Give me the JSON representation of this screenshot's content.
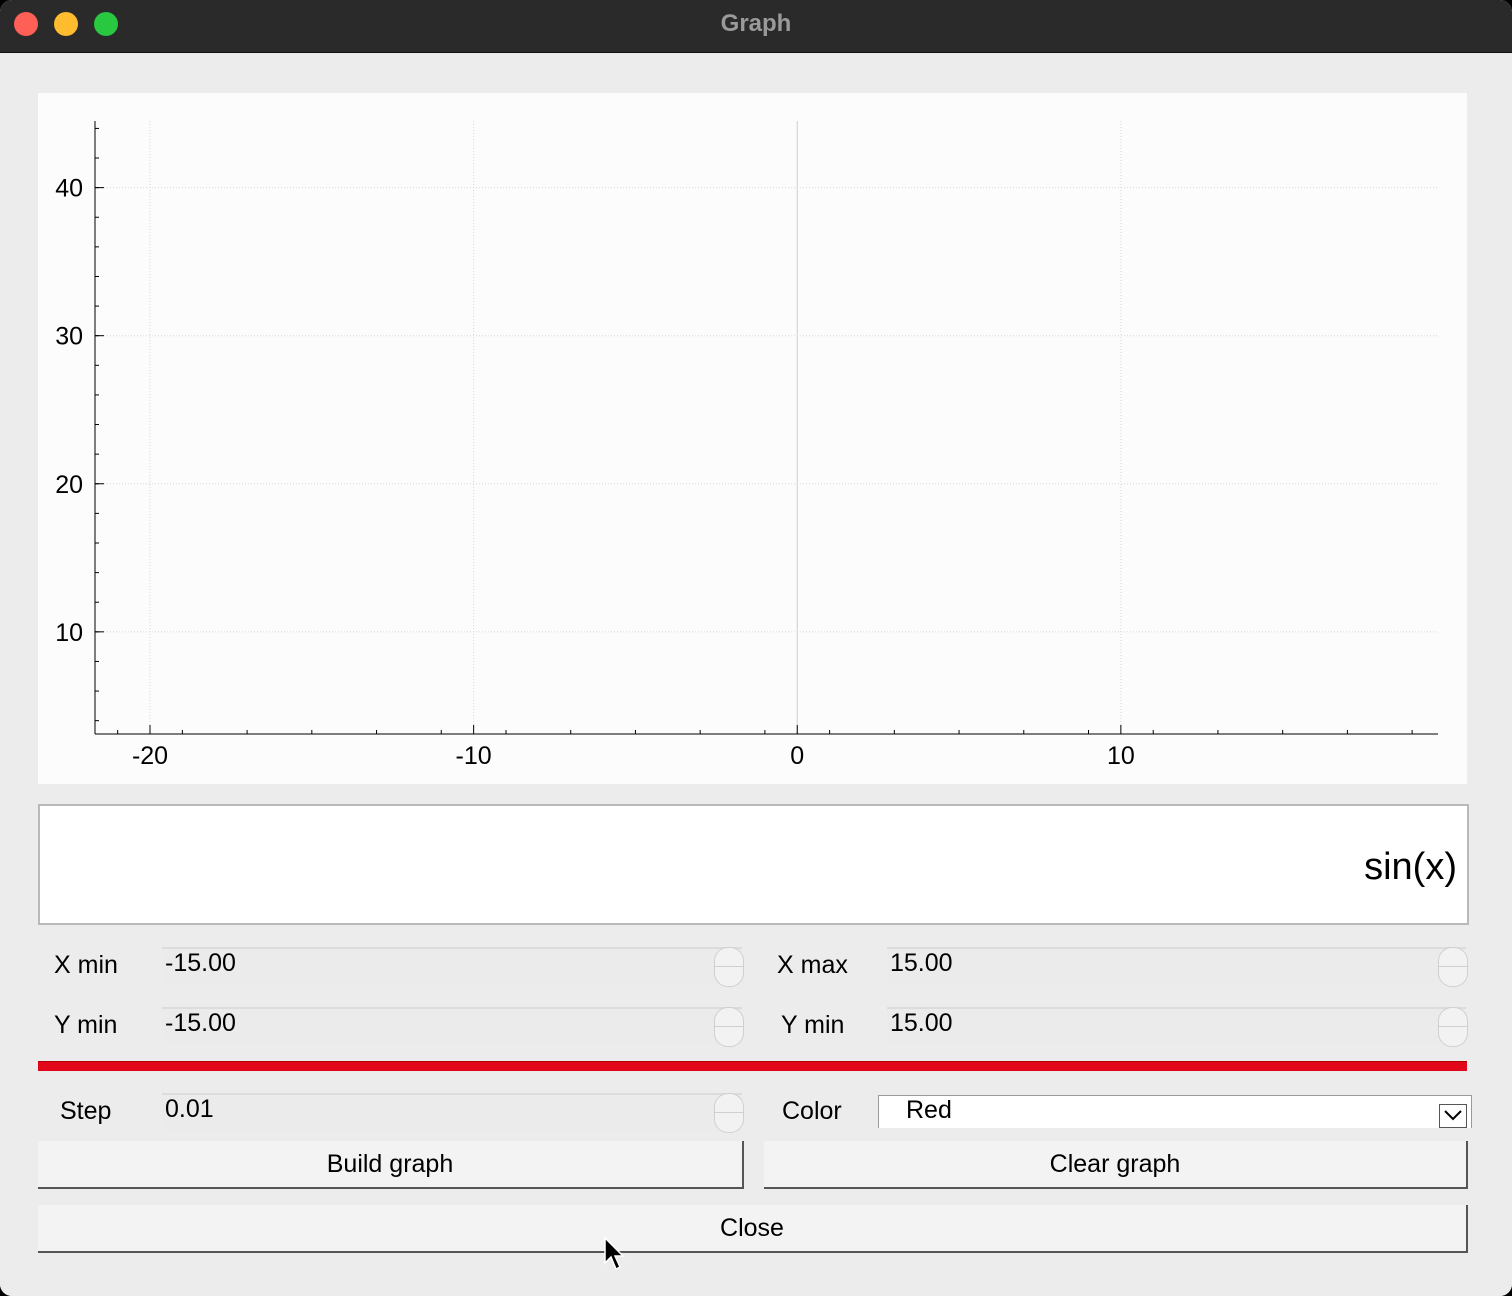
{
  "window": {
    "title": "Graph"
  },
  "chart_data": {
    "type": "line",
    "title": "",
    "xlabel": "",
    "ylabel": "",
    "xlim": [
      -21.7,
      19.8
    ],
    "ylim": [
      3.1,
      44.5
    ],
    "x_ticks": [
      -20,
      -10,
      0,
      10
    ],
    "y_ticks": [
      10,
      20,
      30,
      40
    ],
    "grid": true,
    "series": []
  },
  "expression": {
    "value": "sin(x)"
  },
  "ranges": {
    "xmin": {
      "label": "X min",
      "value": "-15.00"
    },
    "xmax": {
      "label": "X max",
      "value": "15.00"
    },
    "ymin": {
      "label": "Y min",
      "value": "-15.00"
    },
    "ymax": {
      "label": "Y min",
      "value": "15.00"
    }
  },
  "color_preview": "#e2061b",
  "step": {
    "label": "Step",
    "value": "0.01"
  },
  "color": {
    "label": "Color",
    "value": "Red"
  },
  "buttons": {
    "build": "Build graph",
    "clear": "Clear graph",
    "close": "Close"
  }
}
